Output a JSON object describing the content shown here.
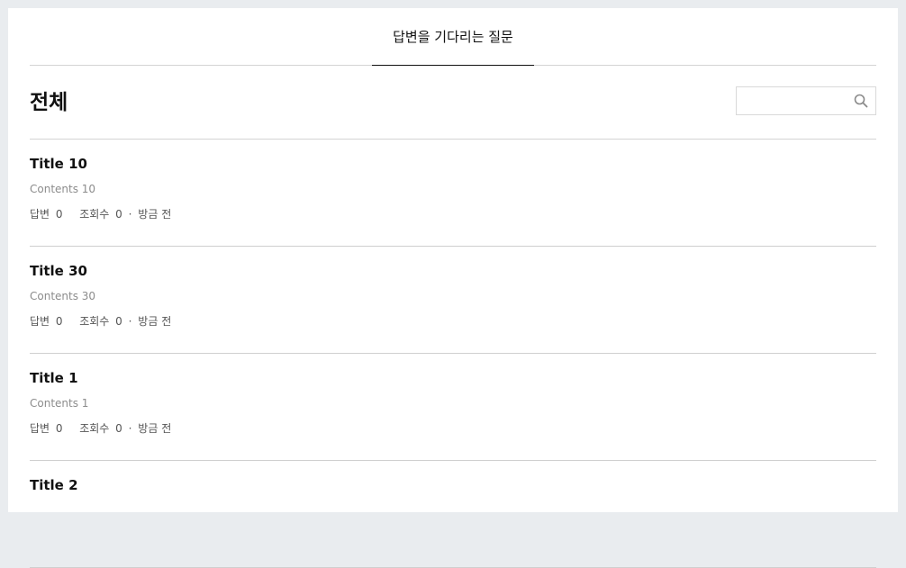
{
  "tabs": {
    "active_label": "답변을 기다리는 질문"
  },
  "header": {
    "title": "전체"
  },
  "search": {
    "placeholder": "",
    "value": ""
  },
  "questions": [
    {
      "title": "Title 10",
      "contents": "Contents 10",
      "answers_label": "답변",
      "answers_count": "0",
      "views_label": "조회수",
      "views_count": "0",
      "separator": "·",
      "time": "방금 전"
    },
    {
      "title": "Title 30",
      "contents": "Contents 30",
      "answers_label": "답변",
      "answers_count": "0",
      "views_label": "조회수",
      "views_count": "0",
      "separator": "·",
      "time": "방금 전"
    },
    {
      "title": "Title 1",
      "contents": "Contents 1",
      "answers_label": "답변",
      "answers_count": "0",
      "views_label": "조회수",
      "views_count": "0",
      "separator": "·",
      "time": "방금 전"
    },
    {
      "title": "Title 2",
      "contents": "",
      "answers_label": "",
      "answers_count": "",
      "views_label": "",
      "views_count": "",
      "separator": "",
      "time": ""
    }
  ]
}
